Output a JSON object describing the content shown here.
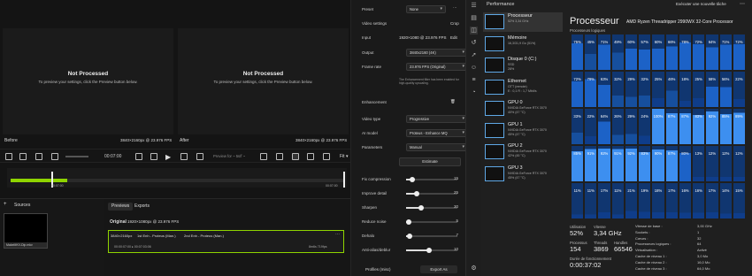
{
  "video_app": {
    "preview_before": {
      "title": "Not Processed",
      "hint": "To preview your settings, click the Preview button below."
    },
    "preview_after": {
      "title": "Not Processed",
      "hint": "To preview your settings, click the Preview button below."
    },
    "before_label": "Before",
    "before_res": "3840×2160px @ 23.976 FPS",
    "after_label": "After",
    "after_res": "3840×2160px @ 23.976 FPS",
    "controls": {
      "timecode": "00:07:00",
      "preview_select": "Preview for ~ 5s/f ~",
      "fit": "Fit ▾"
    },
    "timeline": {
      "start": "00:07:00",
      "end": "00:07:00",
      "progress": 0.17
    },
    "sources": {
      "title": "Sources",
      "add": "+",
      "file": "MakeMKV-Dip.mkv"
    },
    "tabs": {
      "previews": "Previews",
      "exports": "Exports"
    },
    "original": {
      "label": "Original",
      "value": "1920×1080px @ 23.976 FPS"
    },
    "export_card": {
      "res": "3840×2160px",
      "e1": "1st Enh - Proteus (Man.)",
      "e2": "2nd Enh - Proteus (Man.)",
      "time": "00:00:07:00 ▸ 00:07:03:06",
      "fps": "8m6s 719fps"
    },
    "settings": {
      "preset_label": "Preset",
      "preset_value": "None",
      "video_settings": "Video settings",
      "crop": "Crop",
      "input_label": "Input",
      "input_value": "1920×1080 @ 23.976 FPS",
      "edit": "Edit",
      "output_label": "Output",
      "output_value": "3840x2160 (4K)",
      "framerate_label": "Frame rate",
      "framerate_value": "23.976 FPS (Original)",
      "note": "The Enhancement filter has been enabled for high-quality upscaling.",
      "enhancement": "Enhancement",
      "videotype_label": "Video type",
      "videotype_value": "Progressive",
      "aimodel_label": "AI model",
      "aimodel_value": "Proteus - Enhance MQ",
      "params_label": "Parameters",
      "params_value": "Manual",
      "estimate": "Estimate",
      "sliders": [
        {
          "label": "Fix compression",
          "value": "15",
          "pct": 0.12
        },
        {
          "label": "Improve detail",
          "value": "25",
          "pct": 0.2
        },
        {
          "label": "Sharpen",
          "value": "30",
          "pct": 0.3
        },
        {
          "label": "Reduce noise",
          "value": "5",
          "pct": 0.05
        },
        {
          "label": "Dehalo",
          "value": "7",
          "pct": 0.07
        },
        {
          "label": "Anti-alias/deblur",
          "value": "10",
          "pct": 0.45
        }
      ],
      "profiles": "Profiles (misc)",
      "export": "Export As"
    }
  },
  "task_manager": {
    "title": "Performance",
    "new_task": "Exécuter une nouvelle tâche",
    "items": [
      {
        "name": "Processeur",
        "s1": "52%  3,34 GHz",
        "s2": ""
      },
      {
        "name": "Mémoire",
        "s1": "16,3/31,9 Go (51%)",
        "s2": ""
      },
      {
        "name": "Disque 0 (C:)",
        "s1": "SSD",
        "s2": "28%"
      },
      {
        "name": "Ethernet",
        "s1": "OTT (remote)",
        "s2": "E : 0,1 R : 1,7 Mbit/s"
      },
      {
        "name": "GPU 0",
        "s1": "NVIDIA GeForce RTX 3070",
        "s2": "40% (47 °C)"
      },
      {
        "name": "GPU 1",
        "s1": "NVIDIA GeForce RTX 3070",
        "s2": "45% (47 °C)"
      },
      {
        "name": "GPU 2",
        "s1": "NVIDIA GeForce RTX 3070",
        "s2": "42% (45 °C)"
      },
      {
        "name": "GPU 3",
        "s1": "NVIDIA GeForce RTX 3070",
        "s2": "45% (47 °C)"
      }
    ],
    "cpu_title": "Processeur",
    "cpu_name": "AMD Ryzen Threadripper 2990WX 32-Core Processor",
    "logical": "Processeurs logiques",
    "grid": [
      [
        "75%",
        "45%",
        "71%",
        "49%",
        "60%",
        "57%",
        "60%",
        "66%",
        "78%",
        "72%",
        "64%",
        "71%",
        "72%"
      ],
      [
        "72%",
        "79%",
        "63%",
        "32%",
        "29%",
        "32%",
        "25%",
        "46%",
        "18%",
        "25%",
        "58%",
        "56%",
        "22%"
      ],
      [
        "33%",
        "22%",
        "64%",
        "26%",
        "29%",
        "24%",
        "100%",
        "87%",
        "87%",
        "83%",
        "92%",
        "85%",
        "89%"
      ],
      [
        "85%",
        "91%",
        "92%",
        "91%",
        "92%",
        "83%",
        "90%",
        "87%",
        "80%",
        "13%",
        "12%",
        "12%",
        "12%"
      ],
      [
        "11%",
        "11%",
        "17%",
        "11%",
        "21%",
        "19%",
        "18%",
        "17%",
        "16%",
        "16%",
        "17%",
        "14%",
        "15%"
      ]
    ],
    "stats": {
      "util_k": "Utilisation",
      "util_v": "52%",
      "speed_k": "Vitesse",
      "speed_v": "3,34 GHz",
      "proc_k": "Processus",
      "proc_v": "154",
      "threads_k": "Threads",
      "threads_v": "3869",
      "handles_k": "Handles",
      "handles_v": "66546",
      "uptime_k": "Durée de fonctionnement",
      "uptime_v": "0:00:37:02"
    },
    "details": [
      [
        "Vitesse de base :",
        "3,00 GHz"
      ],
      [
        "Sockets :",
        "1"
      ],
      [
        "Cœurs :",
        "32"
      ],
      [
        "Processeurs logiques :",
        "64"
      ],
      [
        "Virtualisation :",
        "Activé"
      ],
      [
        "Cache de niveau 1 :",
        "3,0 Mo"
      ],
      [
        "Cache de niveau 2 :",
        "16,0 Mo"
      ],
      [
        "Cache de niveau 3 :",
        "64,0 Mo"
      ]
    ],
    "colors": {
      "accent": "#5fa8e6",
      "dark": "#0f3d8a",
      "mid": "#1c62c7",
      "light": "#3d8ff0"
    }
  }
}
